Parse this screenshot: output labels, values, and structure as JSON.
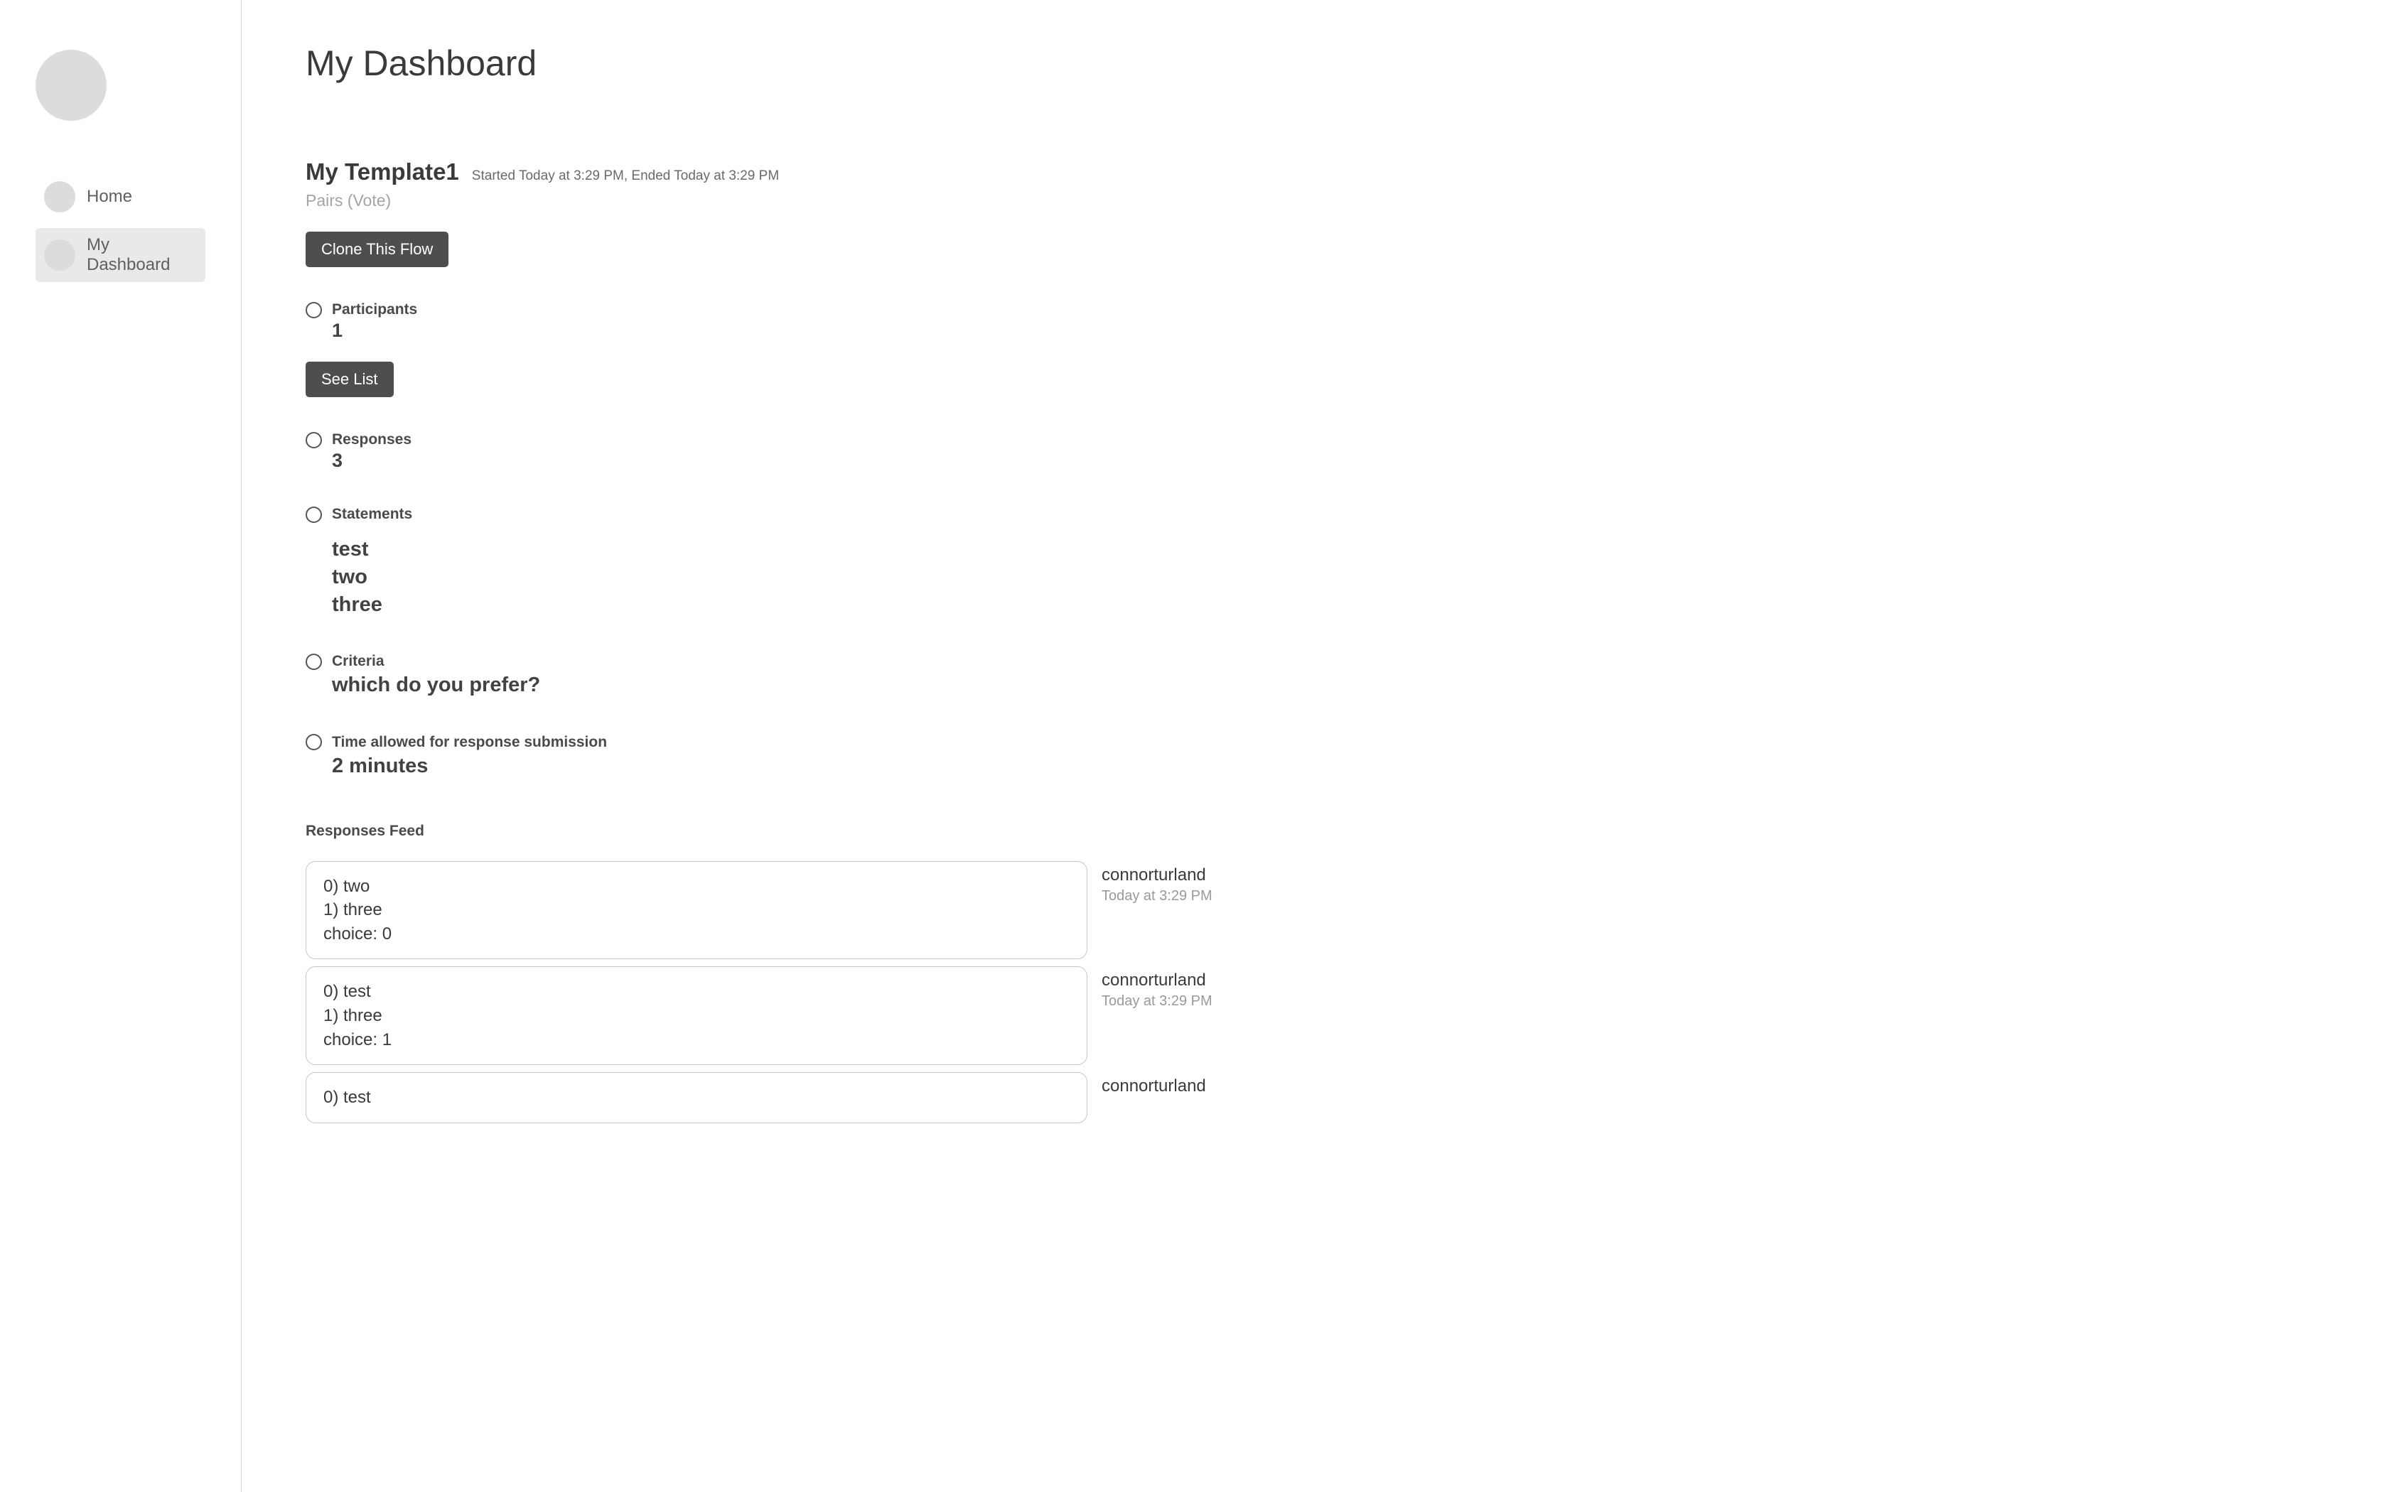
{
  "sidebar": {
    "items": [
      {
        "label": "Home"
      },
      {
        "label": "My Dashboard"
      }
    ]
  },
  "page": {
    "title": "My Dashboard"
  },
  "template": {
    "name": "My Template1",
    "meta": "Started Today at 3:29 PM, Ended Today at 3:29 PM",
    "subtitle": "Pairs (Vote)",
    "clone_button": "Clone This Flow"
  },
  "participants": {
    "label": "Participants",
    "count": "1",
    "see_list_button": "See List"
  },
  "responses": {
    "label": "Responses",
    "count": "3"
  },
  "statements": {
    "label": "Statements",
    "items": [
      "test",
      "two",
      "three"
    ]
  },
  "criteria": {
    "label": "Criteria",
    "value": "which do you prefer?"
  },
  "time_allowed": {
    "label": "Time allowed for response submission",
    "value": "2 minutes"
  },
  "feed": {
    "title": "Responses Feed",
    "entries": [
      {
        "lines": [
          "0) two",
          "1) three",
          "choice: 0"
        ],
        "author": "connorturland",
        "time": "Today at 3:29 PM"
      },
      {
        "lines": [
          "0) test",
          "1) three",
          "choice: 1"
        ],
        "author": "connorturland",
        "time": "Today at 3:29 PM"
      },
      {
        "lines": [
          "0) test"
        ],
        "author": "connorturland",
        "time": ""
      }
    ]
  }
}
